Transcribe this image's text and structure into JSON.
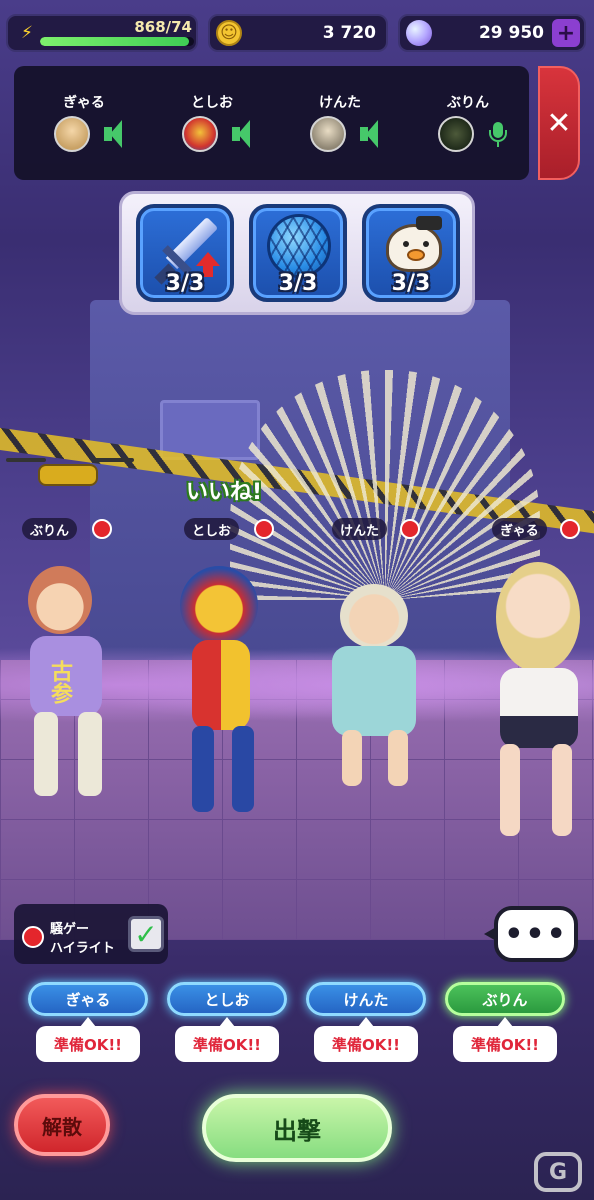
{
  "resources": {
    "energy_text": "868/74",
    "energy_fraction": 0.97,
    "coins": "3 720",
    "gems": "29 950",
    "gem_plus": "+"
  },
  "party": {
    "players": [
      {
        "name": "ぎゃる",
        "voice": "speaker"
      },
      {
        "name": "としお",
        "voice": "speaker"
      },
      {
        "name": "けんた",
        "voice": "speaker"
      },
      {
        "name": "ぶりん",
        "voice": "mic"
      }
    ],
    "close_glyph": "✕"
  },
  "items": [
    {
      "icon": "sword-up-icon",
      "count": "3/3"
    },
    {
      "icon": "blue-ball-icon",
      "count": "3/3"
    },
    {
      "icon": "duck-icon",
      "count": "3/3"
    }
  ],
  "scene": {
    "reaction": "いいね!",
    "tags": [
      "ぶりん",
      "としお",
      "けんた",
      "ぎゃる"
    ],
    "shirt_text": "古参"
  },
  "highlight": {
    "line1": "騒ゲー",
    "line2": "ハイライト",
    "checked": true,
    "check_glyph": "✓"
  },
  "chat_glyph": "•••",
  "ready": [
    {
      "name": "ぎゃる",
      "status": "準備OK!!",
      "color": "blue"
    },
    {
      "name": "としお",
      "status": "準備OK!!",
      "color": "blue"
    },
    {
      "name": "けんた",
      "status": "準備OK!!",
      "color": "blue"
    },
    {
      "name": "ぶりん",
      "status": "準備OK!!",
      "color": "green"
    }
  ],
  "buttons": {
    "disband": "解散",
    "sortie": "出撃"
  },
  "colors": {
    "accent_green": "#46c86a",
    "danger_red": "#e4262c",
    "ready_text": "#e0263a"
  }
}
